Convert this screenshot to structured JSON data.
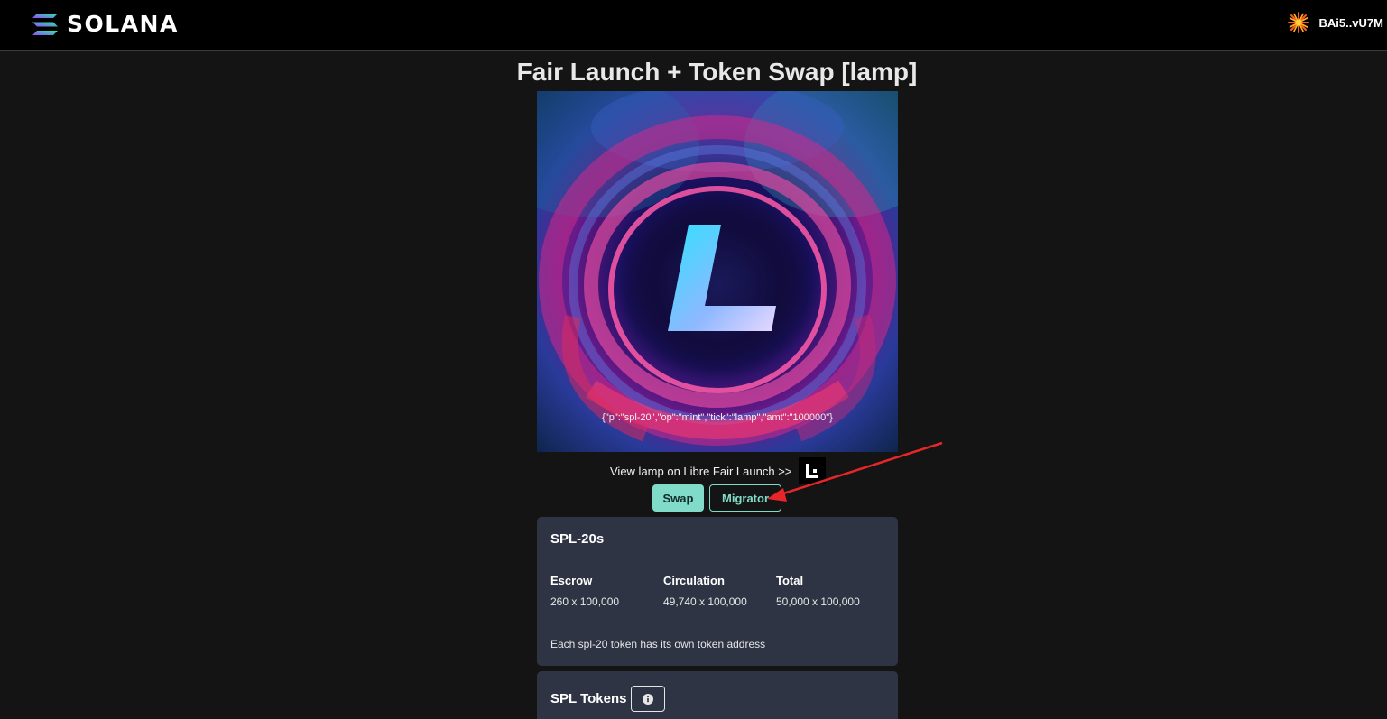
{
  "header": {
    "logo_text": "SOLANA",
    "wallet_label": "BAi5..vU7M",
    "wallet_icon": "starburst-icon"
  },
  "page": {
    "title": "Fair Launch + Token Swap [lamp]"
  },
  "token_image": {
    "inscription_text": "{\"p\":\"spl-20\",\"op\":\"mint\",\"tick\":\"lamp\",\"amt\":\"100000\"}",
    "emblem_letter": "L"
  },
  "libre": {
    "link_text": "View lamp on Libre Fair Launch >>",
    "badge_icon": "libre-logo-icon"
  },
  "tabs": {
    "swap_label": "Swap",
    "migrator_label": "Migrator",
    "active": "Swap"
  },
  "spl20_card": {
    "title": "SPL-20s",
    "stats": [
      {
        "label": "Escrow",
        "value": "260 x 100,000"
      },
      {
        "label": "Circulation",
        "value": "49,740 x 100,000"
      },
      {
        "label": "Total",
        "value": "50,000 x 100,000"
      }
    ],
    "note": "Each spl-20 token has its own token address"
  },
  "spl_tokens_card": {
    "title": "SPL Tokens",
    "info_icon": "info-icon"
  },
  "colors": {
    "accent": "#80dcc8",
    "card_bg": "#2e3443",
    "page_bg": "#141414",
    "annotation_arrow": "#e8262a"
  }
}
